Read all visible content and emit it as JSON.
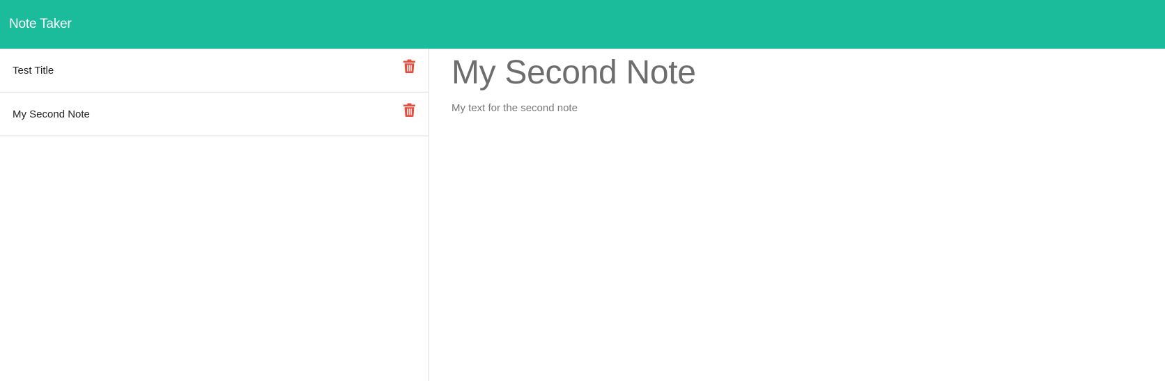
{
  "header": {
    "brand": "Note Taker",
    "background_color": "#1abc9c"
  },
  "notes": [
    {
      "title": "Test Title",
      "delete_icon": "trash-icon"
    },
    {
      "title": "My Second Note",
      "delete_icon": "trash-icon"
    }
  ],
  "active_note": {
    "title": "My Second Note",
    "text": "My text for the second note"
  },
  "colors": {
    "delete_icon": "#e74c3c",
    "note_title_text": "#6d6d6d"
  }
}
